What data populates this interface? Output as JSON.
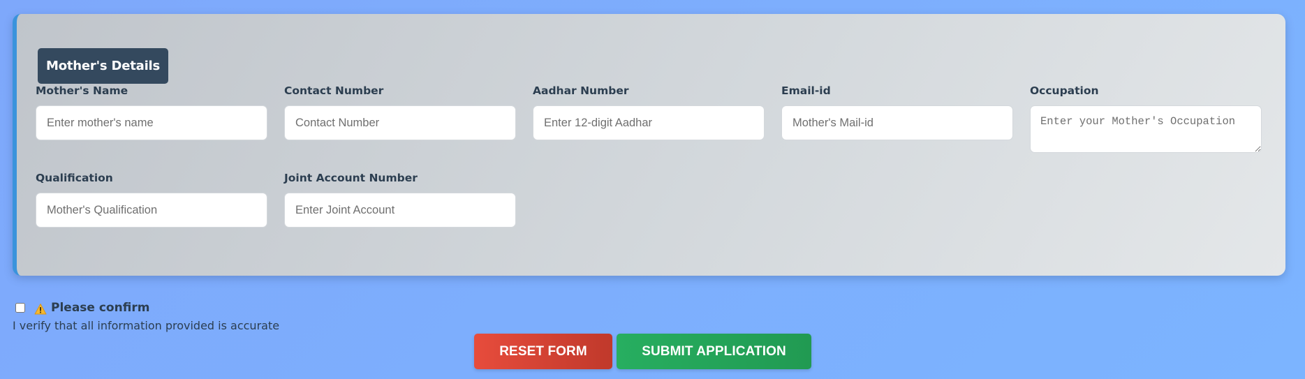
{
  "section": {
    "title": "Mother's Details"
  },
  "fields": {
    "mother_name": {
      "label": "Mother's Name",
      "placeholder": "Enter mother's name",
      "value": ""
    },
    "contact_number": {
      "label": "Contact Number",
      "placeholder": "Contact Number",
      "value": ""
    },
    "aadhar_number": {
      "label": "Aadhar Number",
      "placeholder": "Enter 12-digit Aadhar",
      "value": ""
    },
    "email": {
      "label": "Email-id",
      "placeholder": "Mother's Mail-id",
      "value": ""
    },
    "occupation": {
      "label": "Occupation",
      "placeholder": "Enter your Mother's Occupation",
      "value": ""
    },
    "qualification": {
      "label": "Qualification",
      "placeholder": "Mother's Qualification",
      "value": ""
    },
    "joint_account": {
      "label": "Joint Account Number",
      "placeholder": "Enter Joint Account",
      "value": ""
    }
  },
  "confirm": {
    "checked": false,
    "icon": "warning-icon",
    "label": "Please confirm",
    "verify_text": "I verify that all information provided is accurate"
  },
  "buttons": {
    "reset_label": "RESET FORM",
    "submit_label": "SUBMIT APPLICATION"
  },
  "colors": {
    "background": "#7eaefc",
    "section_title_bg": "#34495e",
    "accent_border": "#3a93dc",
    "reset_button": "#e74c3c",
    "submit_button": "#27ae60"
  }
}
